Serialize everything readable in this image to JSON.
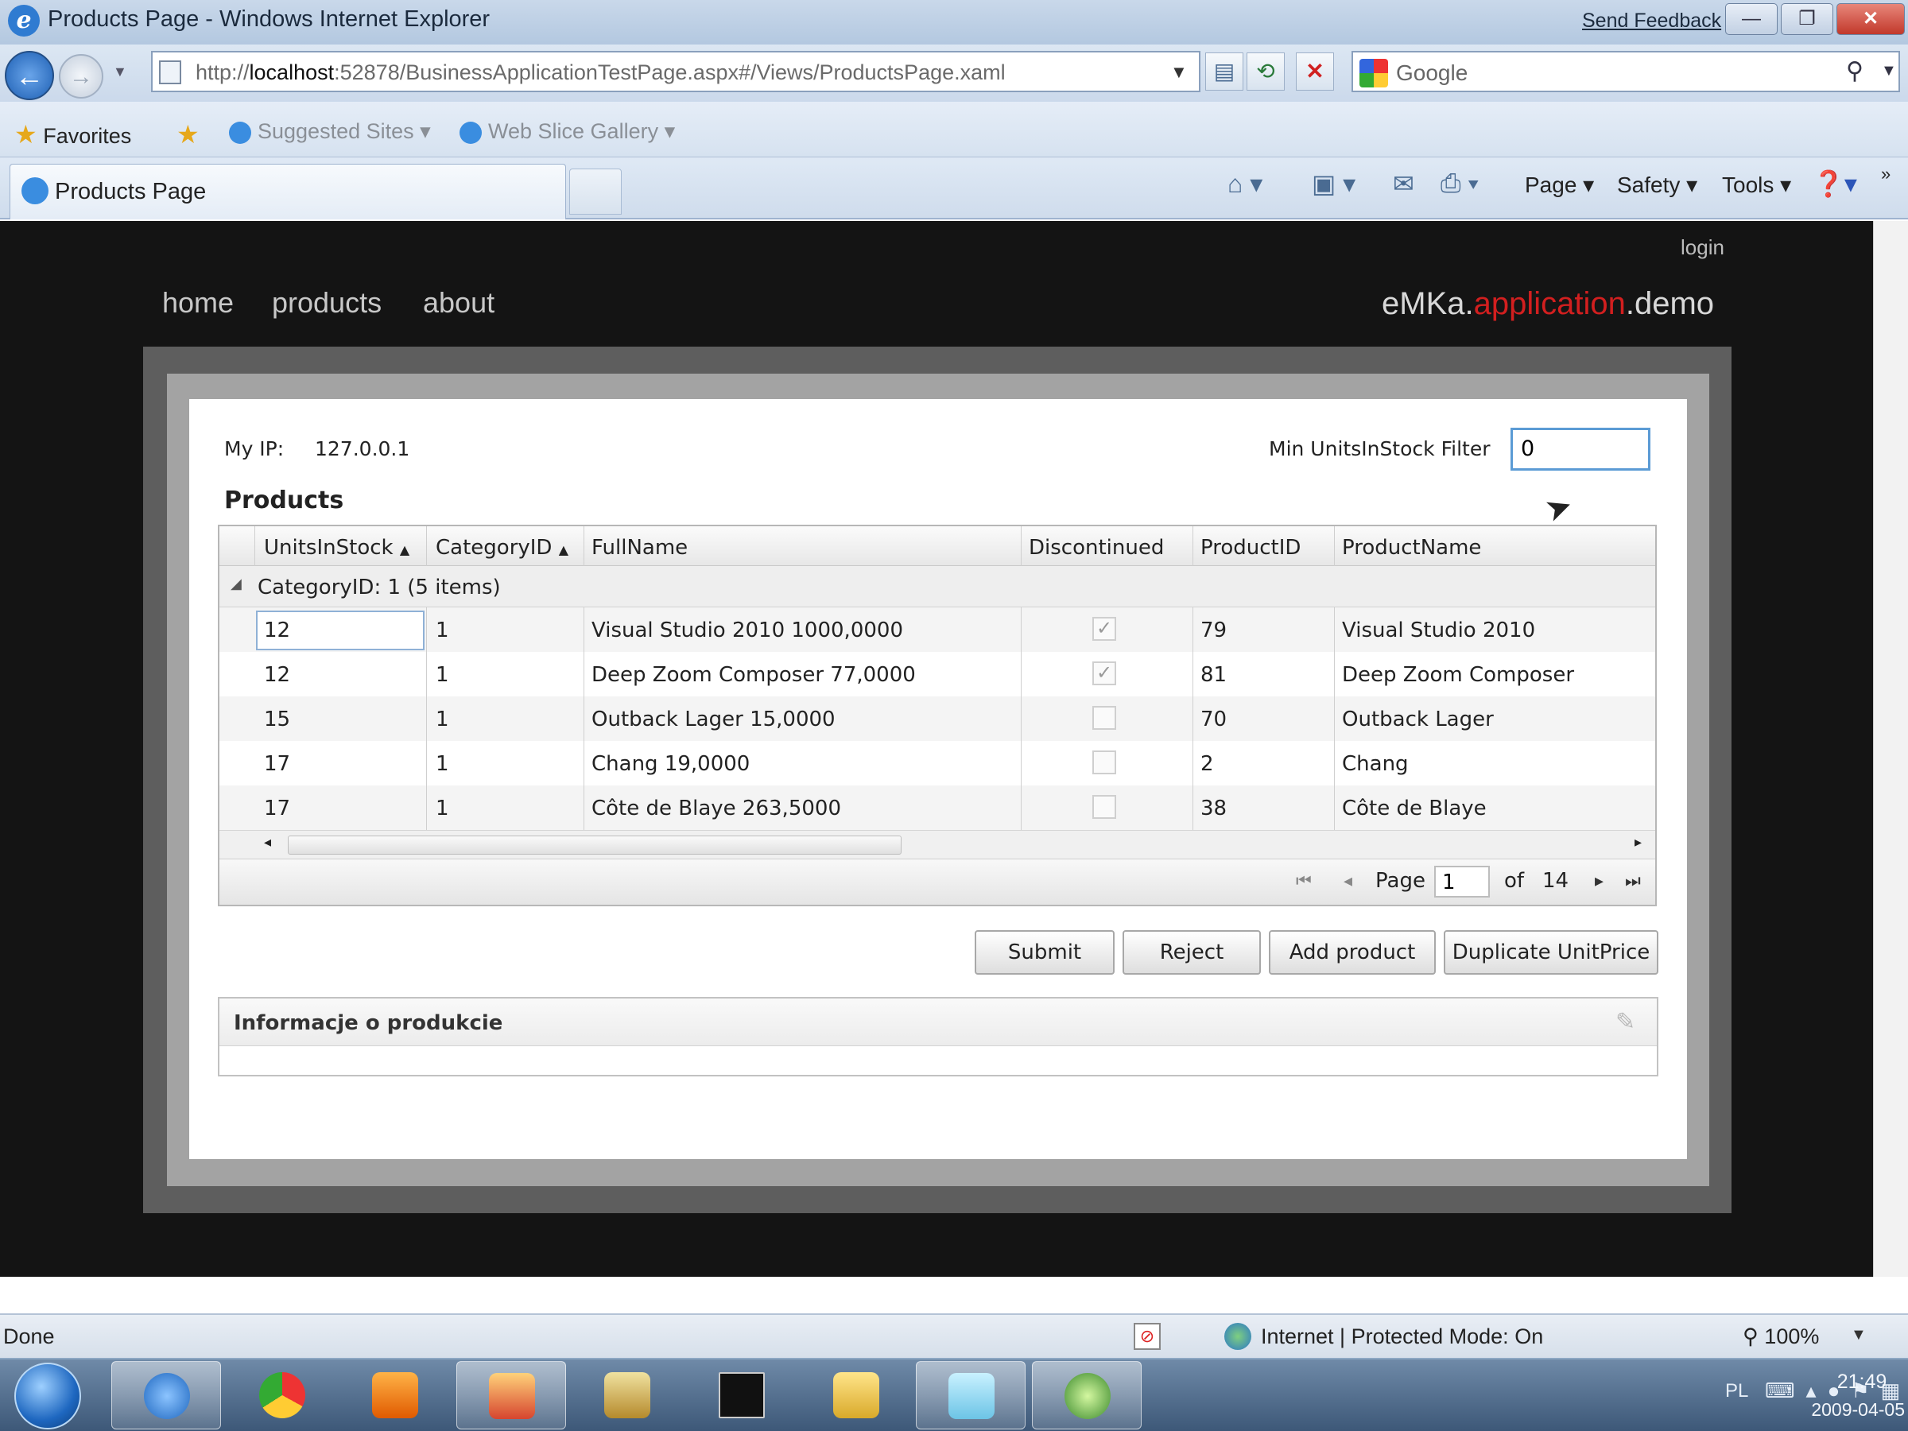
{
  "window": {
    "title": "Products Page - Windows Internet Explorer",
    "feedback": "Send Feedback",
    "min": "—",
    "max": "❐",
    "close": "✕"
  },
  "address": {
    "url_prefix": "http://",
    "url_host": "localhost",
    "url_rest": ":52878/BusinessApplicationTestPage.aspx#/Views/ProductsPage.xaml",
    "search_placeholder": "Google"
  },
  "favorites": {
    "label": "Favorites",
    "suggested": "Suggested Sites",
    "webslice": "Web Slice Gallery"
  },
  "tabs": {
    "active_label": "Products Page"
  },
  "commands": {
    "page": "Page",
    "safety": "Safety",
    "tools": "Tools"
  },
  "app": {
    "login": "login",
    "nav": [
      "home",
      "products",
      "about"
    ],
    "brand_a": "eMKa.",
    "brand_b": "application",
    "brand_c": ".demo",
    "my_ip_label": "My IP:",
    "my_ip_value": "127.0.0.1",
    "filter_label": "Min UnitsInStock Filter",
    "filter_value": "0",
    "products_heading": "Products",
    "grid": {
      "columns": [
        "UnitsInStock",
        "CategoryID",
        "FullName",
        "Discontinued",
        "ProductID",
        "ProductName"
      ],
      "group_label": "CategoryID: 1 (5 items)",
      "rows": [
        {
          "units": "12",
          "category": "1",
          "fullname": "Visual Studio 2010 1000,0000",
          "discontinued": true,
          "id": "79",
          "name": "Visual Studio 2010"
        },
        {
          "units": "12",
          "category": "1",
          "fullname": "Deep Zoom Composer 77,0000",
          "discontinued": true,
          "id": "81",
          "name": "Deep Zoom Composer"
        },
        {
          "units": "15",
          "category": "1",
          "fullname": "Outback Lager 15,0000",
          "discontinued": false,
          "id": "70",
          "name": "Outback Lager"
        },
        {
          "units": "17",
          "category": "1",
          "fullname": "Chang 19,0000",
          "discontinued": false,
          "id": "2",
          "name": "Chang"
        },
        {
          "units": "17",
          "category": "1",
          "fullname": "Côte de Blaye 263,5000",
          "discontinued": false,
          "id": "38",
          "name": "Côte de Blaye"
        }
      ],
      "pager": {
        "page_label": "Page",
        "page_value": "1",
        "of_label": "of",
        "total_pages": "14"
      }
    },
    "buttons": {
      "submit": "Submit",
      "reject": "Reject",
      "add_product": "Add product",
      "duplicate": "Duplicate UnitPrice"
    },
    "info_title": "Informacje o produkcie"
  },
  "status": {
    "text": "Done",
    "zone": "Internet | Protected Mode: On",
    "zoom": "100%"
  },
  "taskbar": {
    "lang": "PL",
    "time": "21:49",
    "date": "2009-04-05"
  },
  "colors": {
    "brand_red": "#d21f1f",
    "content_bg": "#141414",
    "focus_blue": "#5b9bd5"
  }
}
